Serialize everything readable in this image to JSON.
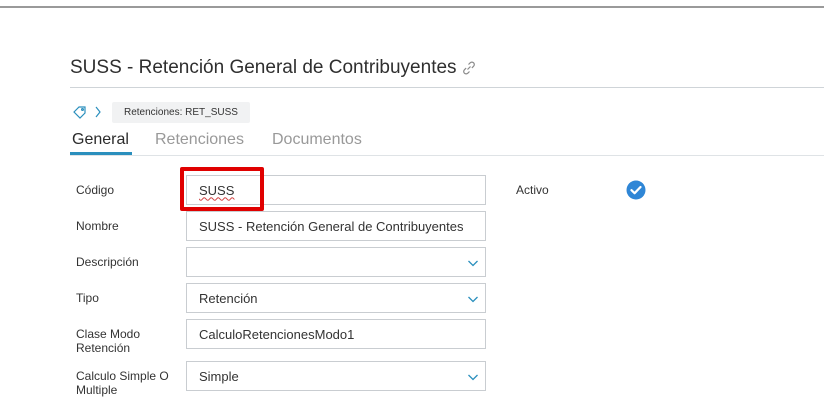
{
  "page": {
    "title": "SUSS - Retención General de Contribuyentes",
    "breadcrumb": "Retenciones: RET_SUSS"
  },
  "tabs": [
    {
      "label": "General",
      "active": true
    },
    {
      "label": "Retenciones",
      "active": false
    },
    {
      "label": "Documentos",
      "active": false
    }
  ],
  "form": {
    "codigo": {
      "label": "Código",
      "value": "SUSS"
    },
    "nombre": {
      "label": "Nombre",
      "value": "SUSS - Retención General de Contribuyentes"
    },
    "descripcion": {
      "label": "Descripción",
      "value": ""
    },
    "tipo": {
      "label": "Tipo",
      "value": "Retención"
    },
    "clase_modo": {
      "label_line1": "Clase Modo",
      "label_line2": "Retención",
      "value": "CalculoRetencionesModo1"
    },
    "calculo": {
      "label_line1": "Calculo Simple O",
      "label_line2": "Multiple",
      "value": "Simple"
    },
    "activo": {
      "label": "Activo",
      "checked": true
    }
  },
  "colors": {
    "accent": "#2a8fbd",
    "checkbox": "#2f86d6",
    "highlight": "#e00000"
  },
  "icons": [
    "link-icon",
    "tag-icon",
    "chevron-right-icon",
    "chevron-down-icon",
    "check-circle-icon"
  ]
}
